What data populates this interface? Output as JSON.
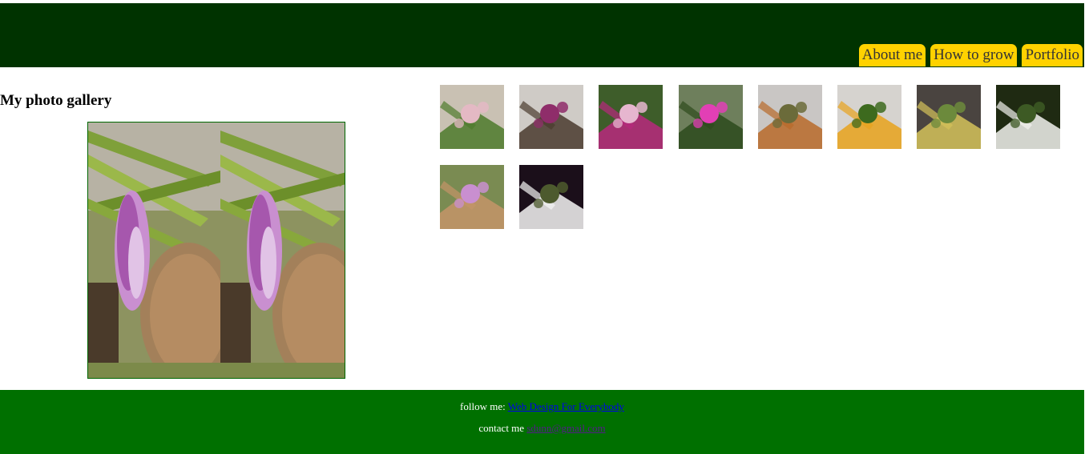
{
  "nav": {
    "items": [
      {
        "label": "About me"
      },
      {
        "label": "How to grow"
      },
      {
        "label": "Portfolio"
      }
    ]
  },
  "gallery": {
    "title": "My photo gallery"
  },
  "thumbnails": [
    {
      "icon": "green-orchid-leaves-photo",
      "colors": [
        "#c9c1b3",
        "#4e7a2c",
        "#e4b9c4"
      ]
    },
    {
      "icon": "purple-orchid-stem-photo",
      "colors": [
        "#cfcbc6",
        "#4a3b2e",
        "#8f2d6a"
      ]
    },
    {
      "icon": "magenta-orchid-cluster-photo",
      "colors": [
        "#3e5d2a",
        "#b8287e",
        "#e6b6cf"
      ]
    },
    {
      "icon": "pink-orchid-garden-photo",
      "colors": [
        "#6e7f5c",
        "#2d4a1c",
        "#e23fb5"
      ]
    },
    {
      "icon": "orange-spotted-orchid-photo",
      "colors": [
        "#c9c6c4",
        "#b86a2a",
        "#6b6b3a"
      ]
    },
    {
      "icon": "yellow-orchid-photo",
      "colors": [
        "#d6d3cf",
        "#e8a21c",
        "#3d6a1e"
      ]
    },
    {
      "icon": "yellow-cluster-orchid-photo",
      "colors": [
        "#4a4440",
        "#d4c25a",
        "#6c8a3c"
      ]
    },
    {
      "icon": "white-orchid-photo",
      "colors": [
        "#1f2a12",
        "#f2f2ee",
        "#3d5a24"
      ]
    },
    {
      "icon": "pink-vanda-orchid-photo",
      "colors": [
        "#7a8b52",
        "#c49468",
        "#c98fd0"
      ]
    },
    {
      "icon": "white-orchid-dark-photo",
      "colors": [
        "#1b0f1a",
        "#f5f5f5",
        "#4d5a2e"
      ]
    }
  ],
  "footer": {
    "follow_label": "follow me:",
    "follow_link": "Web Design For Everybody",
    "contact_label": "contact me",
    "contact_link": "sdunn@gmail.com"
  },
  "colors": {
    "header_bg": "#003300",
    "nav_bg": "#ffd200",
    "footer_bg": "#007000"
  }
}
